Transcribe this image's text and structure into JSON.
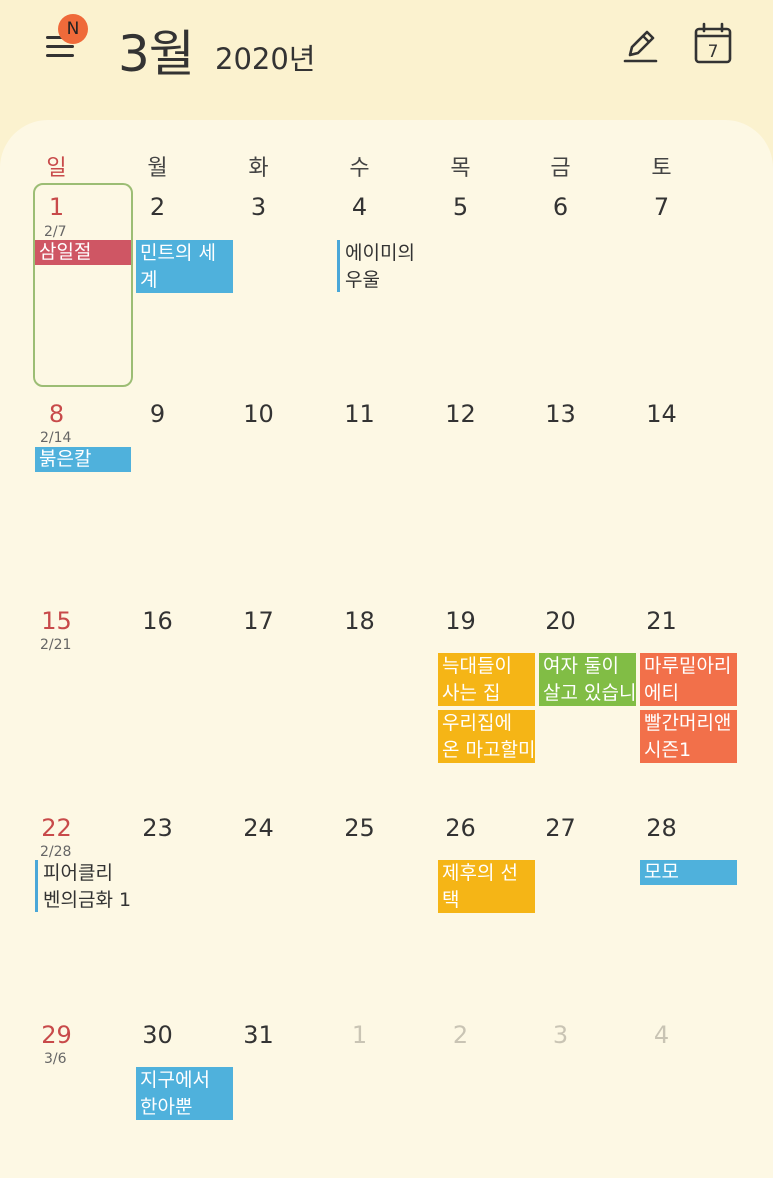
{
  "header": {
    "badge": "N",
    "month": "3월",
    "year": "2020년"
  },
  "icons": {
    "menu": "menu-icon",
    "edit": "pencil-icon",
    "today": "calendar-today-icon",
    "today_date": "7"
  },
  "weekdays": [
    "일",
    "월",
    "화",
    "수",
    "목",
    "금",
    "토"
  ],
  "weeks": [
    {
      "days": [
        "1",
        "2",
        "3",
        "4",
        "5",
        "6",
        "7"
      ],
      "lunar": "2/7"
    },
    {
      "days": [
        "8",
        "9",
        "10",
        "11",
        "12",
        "13",
        "14"
      ],
      "lunar": "2/14"
    },
    {
      "days": [
        "15",
        "16",
        "17",
        "18",
        "19",
        "20",
        "21"
      ],
      "lunar": "2/21"
    },
    {
      "days": [
        "22",
        "23",
        "24",
        "25",
        "26",
        "27",
        "28"
      ],
      "lunar": "2/28"
    },
    {
      "days": [
        "29",
        "30",
        "31",
        "1",
        "2",
        "3",
        "4"
      ],
      "lunar": "3/6"
    }
  ],
  "events": {
    "samiljeol": [
      "삼일절"
    ],
    "mint": [
      "민트의 세",
      "계"
    ],
    "amy": [
      "에이미의",
      "우울"
    ],
    "red_knife": [
      "붉은칼"
    ],
    "wolves": [
      "늑대들이",
      "사는 집"
    ],
    "women": [
      "여자 둘이",
      "살고 있습니"
    ],
    "attic": [
      "마루밑아리",
      "에티"
    ],
    "majo": [
      "우리집에",
      "온 마고할미"
    ],
    "anne": [
      "빨간머리앤",
      "시즌1"
    ],
    "pierre": [
      "피어클리",
      "벤의금화 1"
    ],
    "jehu": [
      "제후의 선",
      "택"
    ],
    "momo": [
      "모모"
    ],
    "only_one": [
      "지구에서",
      "한아뿐"
    ]
  },
  "colors": {
    "holiday": "#cf5664",
    "blue": "#4fb1dc",
    "yellow": "#f5b516",
    "green": "#81bd45",
    "orange": "#f2704a",
    "today_border": "#9cbd74",
    "badge": "#ef6a3a"
  }
}
